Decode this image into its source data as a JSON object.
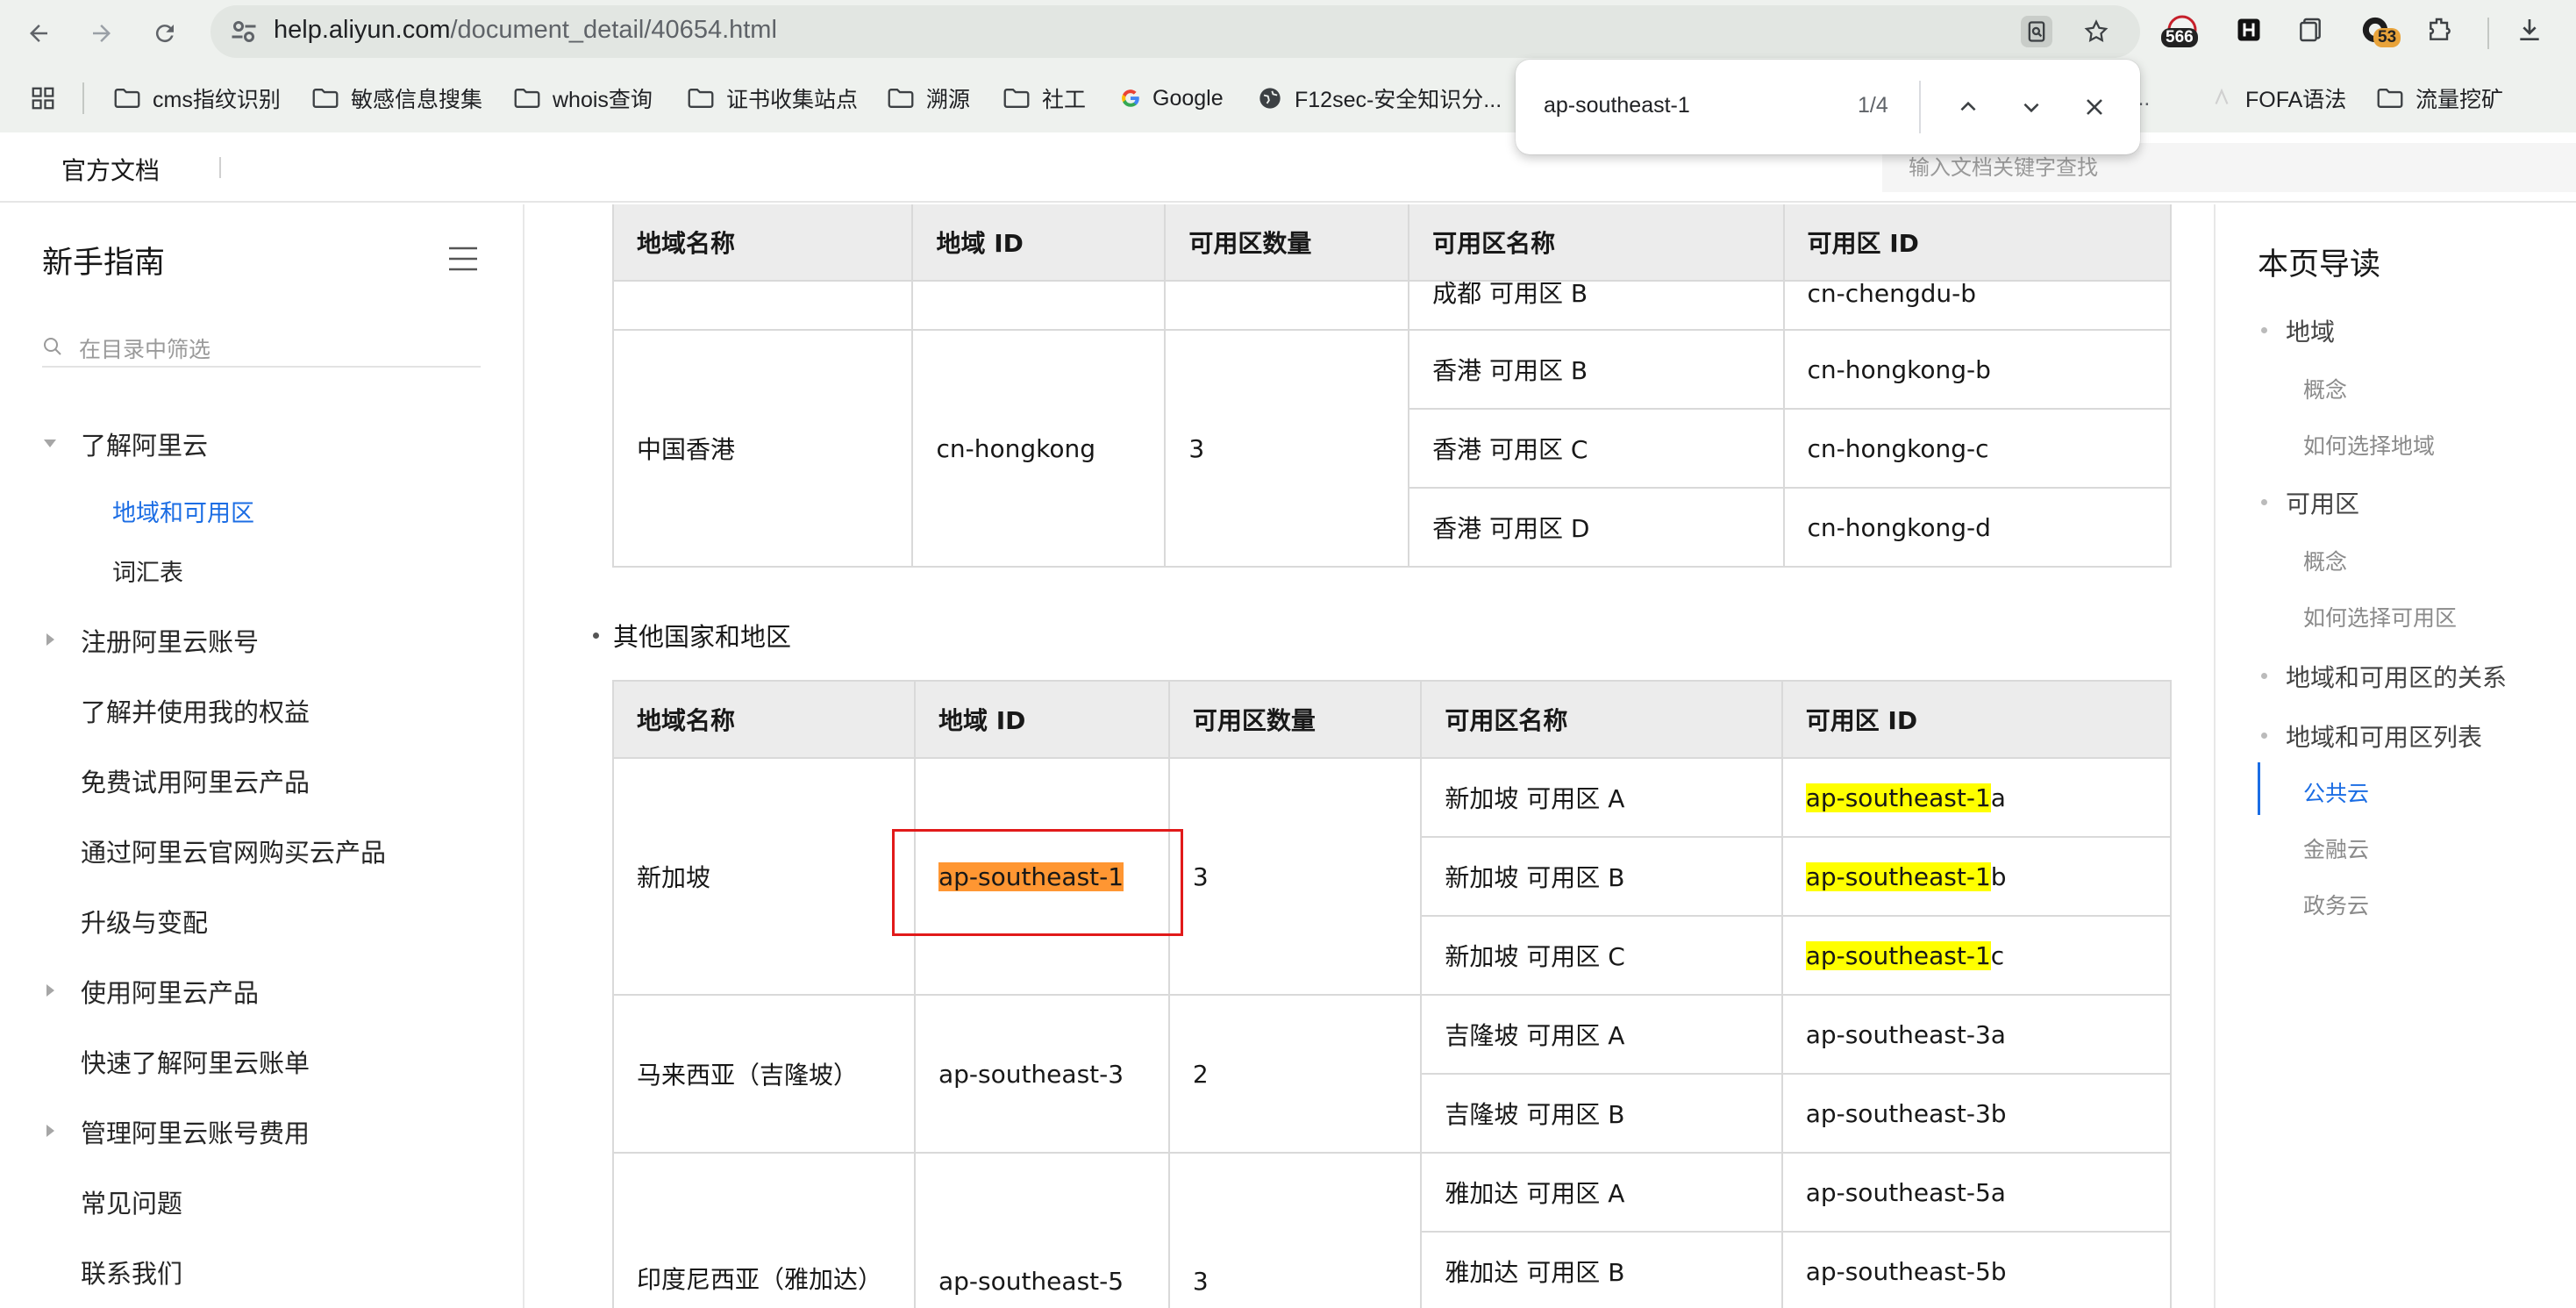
{
  "browser": {
    "url_host": "help.aliyun.com",
    "url_path": "/document_detail/40654.html",
    "extensions": {
      "badge_1": "566",
      "badge_3": "53"
    },
    "bookmarks": [
      "cms指纹识别",
      "敏感信息搜集",
      "whois查询",
      "证书收集站点",
      "溯源",
      "社工",
      "Google",
      "F12sec-安全知识分...",
      "ti...",
      "FOFA语法",
      "流量挖矿"
    ]
  },
  "find_bar": {
    "query": "ap-southeast-1",
    "count": "1/4"
  },
  "header": {
    "title": "官方文档",
    "search_placeholder": "输入文档关键字查找"
  },
  "sidebar": {
    "title": "新手指南",
    "filter_placeholder": "在目录中筛选",
    "items": [
      {
        "label": "了解阿里云",
        "caret": "down"
      },
      {
        "label": "地域和可用区",
        "sub": true,
        "active": true
      },
      {
        "label": "词汇表",
        "sub": true
      },
      {
        "label": "注册阿里云账号",
        "caret": "right"
      },
      {
        "label": "了解并使用我的权益"
      },
      {
        "label": "免费试用阿里云产品"
      },
      {
        "label": "通过阿里云官网购买云产品"
      },
      {
        "label": "升级与变配"
      },
      {
        "label": "使用阿里云产品",
        "caret": "right"
      },
      {
        "label": "快速了解阿里云账单"
      },
      {
        "label": "管理阿里云账号费用",
        "caret": "right"
      },
      {
        "label": "常见问题"
      },
      {
        "label": "联系我们"
      }
    ]
  },
  "content": {
    "columns": [
      "地域名称",
      "地域 ID",
      "可用区数量",
      "可用区名称",
      "可用区 ID"
    ],
    "table1": {
      "partial_row": {
        "zone_name": "成都 可用区 B",
        "zone_id": "cn-chengdu-b"
      },
      "region": {
        "name": "中国香港",
        "id": "cn-hongkong",
        "count": "3"
      },
      "zones": [
        {
          "name": "香港 可用区 B",
          "id": "cn-hongkong-b"
        },
        {
          "name": "香港 可用区 C",
          "id": "cn-hongkong-c"
        },
        {
          "name": "香港 可用区 D",
          "id": "cn-hongkong-d"
        }
      ]
    },
    "other_heading": "其他国家和地区",
    "table2": {
      "singapore": {
        "name": "新加坡",
        "id": "ap-southeast-1",
        "count": "3",
        "zones": [
          {
            "name": "新加坡 可用区 A",
            "id_hl": "ap-southeast-1",
            "id_rest": "a"
          },
          {
            "name": "新加坡 可用区 B",
            "id_hl": "ap-southeast-1",
            "id_rest": "b"
          },
          {
            "name": "新加坡 可用区 C",
            "id_hl": "ap-southeast-1",
            "id_rest": "c"
          }
        ]
      },
      "malaysia": {
        "name": "马来西亚（吉隆坡）",
        "id": "ap-southeast-3",
        "count": "2",
        "zones": [
          {
            "name": "吉隆坡 可用区 A",
            "id": "ap-southeast-3a"
          },
          {
            "name": "吉隆坡 可用区 B",
            "id": "ap-southeast-3b"
          }
        ]
      },
      "indonesia": {
        "name": "印度尼西亚（雅加达）",
        "id": "ap-southeast-5",
        "count": "3",
        "zones": [
          {
            "name": "雅加达 可用区 A",
            "id": "ap-southeast-5a"
          },
          {
            "name": "雅加达 可用区 B",
            "id": "ap-southeast-5b"
          }
        ]
      }
    }
  },
  "toc": {
    "title": "本页导读",
    "items": [
      "地域",
      "概念",
      "如何选择地域",
      "可用区",
      "概念",
      "如何选择可用区",
      "地域和可用区的关系",
      "地域和可用区列表",
      "公共云",
      "金融云",
      "政务云"
    ]
  },
  "colors": {
    "accent": "#1b6de4",
    "find_current": "#ff9632",
    "find_match": "#ffff00",
    "annotation_red": "#e11a1a"
  }
}
